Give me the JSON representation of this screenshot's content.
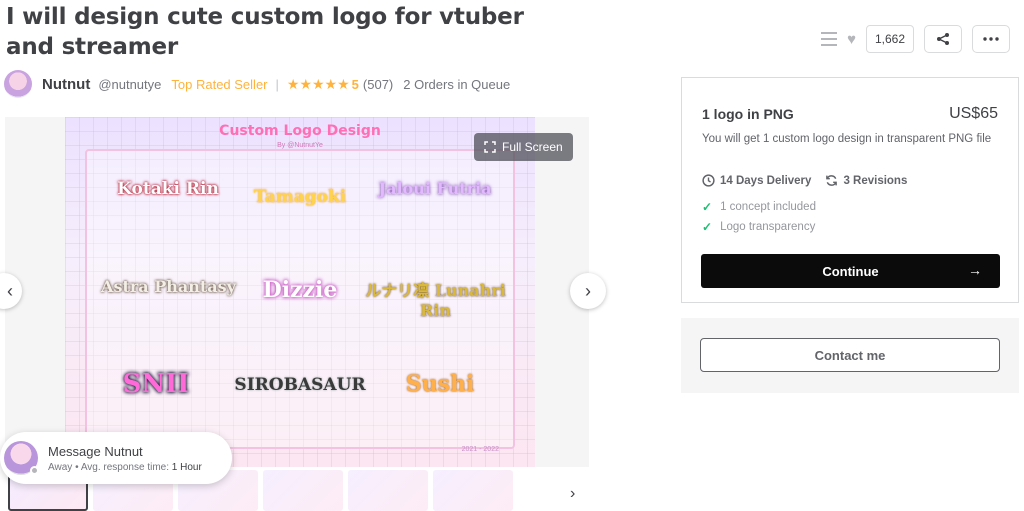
{
  "gig": {
    "title": "I will design cute custom logo for vtuber and streamer"
  },
  "seller": {
    "name": "Nutnut",
    "handle": "@nutnutye",
    "level": "Top Rated Seller",
    "separator": "|",
    "stars": "★★★★★",
    "rating": "5",
    "review_count": "(507)",
    "queue": "2 Orders in Queue"
  },
  "actions": {
    "likes": "1,662",
    "icons": [
      "list-icon",
      "heart-icon",
      "share-icon",
      "more-icon"
    ]
  },
  "gallery": {
    "fullscreen_label": "Full Screen",
    "artwork": {
      "heading": "Custom Logo Design",
      "subheading": "By @NutnutYe",
      "year": "2021 - 2022",
      "logos": [
        "Kotaki Rin",
        "Tamagoki",
        "Jaloui Futria",
        "Astra Phantasy",
        "Dizzie",
        "ルナリ凛 Lunahri Rin",
        "SNII",
        "SIROBASAUR",
        "Sushi"
      ]
    }
  },
  "message": {
    "title": "Message Nutnut",
    "status": "Away",
    "bullet": "•",
    "response_label": "Avg. response time:",
    "response_value": "1 Hour"
  },
  "package": {
    "title": "1 logo in PNG",
    "price": "US$65",
    "description": "You will get 1 custom logo design in transparent PNG file",
    "delivery": "14 Days Delivery",
    "revisions": "3 Revisions",
    "features": [
      "1 concept included",
      "Logo transparency"
    ],
    "continue_label": "Continue",
    "contact_label": "Contact me"
  },
  "colors": {
    "accent_orange": "#ffb33e",
    "check_green": "#1dbf73",
    "button_black": "#0b0b0b"
  }
}
